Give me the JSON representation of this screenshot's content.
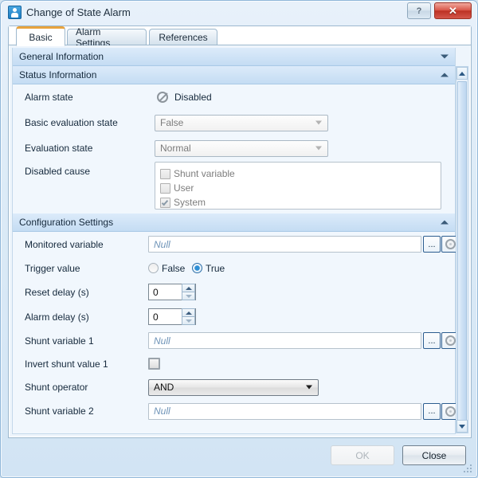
{
  "window": {
    "title": "Change of State Alarm",
    "app_icon": "alarm-app-icon",
    "help_label": "?",
    "close_label": "✕"
  },
  "tabs": [
    {
      "label": "Basic",
      "active": true
    },
    {
      "label": "Alarm Settings",
      "active": false
    },
    {
      "label": "References",
      "active": false
    }
  ],
  "sections": {
    "general": {
      "title": "General Information",
      "expanded": false
    },
    "status": {
      "title": "Status Information",
      "expanded": true
    },
    "configuration": {
      "title": "Configuration Settings",
      "expanded": true
    }
  },
  "status_fields": {
    "alarm_state": {
      "label": "Alarm state",
      "value": "Disabled",
      "icon": "prohibited-icon"
    },
    "basic_evaluation_state": {
      "label": "Basic evaluation state",
      "value": "False",
      "enabled": false
    },
    "evaluation_state": {
      "label": "Evaluation state",
      "value": "Normal",
      "enabled": false
    },
    "disabled_cause": {
      "label": "Disabled cause",
      "options": [
        {
          "label": "Shunt variable",
          "checked": false
        },
        {
          "label": "User",
          "checked": false
        },
        {
          "label": "System",
          "checked": true
        }
      ]
    }
  },
  "config_fields": {
    "monitored_variable": {
      "label": "Monitored variable",
      "placeholder": "Null",
      "browse_label": "...",
      "settings_icon": "gear-icon"
    },
    "trigger_value": {
      "label": "Trigger value",
      "options": [
        {
          "label": "False",
          "selected": false
        },
        {
          "label": "True",
          "selected": true
        }
      ]
    },
    "reset_delay": {
      "label": "Reset delay (s)",
      "value": "0"
    },
    "alarm_delay": {
      "label": "Alarm delay (s)",
      "value": "0"
    },
    "shunt_variable_1": {
      "label": "Shunt variable 1",
      "placeholder": "Null",
      "browse_label": "...",
      "settings_icon": "gear-icon"
    },
    "invert_shunt_value_1": {
      "label": "Invert shunt value 1",
      "checked": false
    },
    "shunt_operator": {
      "label": "Shunt operator",
      "value": "AND",
      "enabled": true
    },
    "shunt_variable_2": {
      "label": "Shunt variable 2",
      "placeholder": "Null",
      "browse_label": "...",
      "settings_icon": "gear-icon"
    }
  },
  "footer": {
    "ok_label": "OK",
    "ok_enabled": false,
    "close_label": "Close",
    "close_enabled": true
  },
  "colors": {
    "accent_tab": "#e8a33d",
    "close_button": "#bd3124",
    "section_header": "#c4dcf3",
    "radio_selected": "#2e8fd6",
    "placeholder_text": "#6f94b8"
  }
}
